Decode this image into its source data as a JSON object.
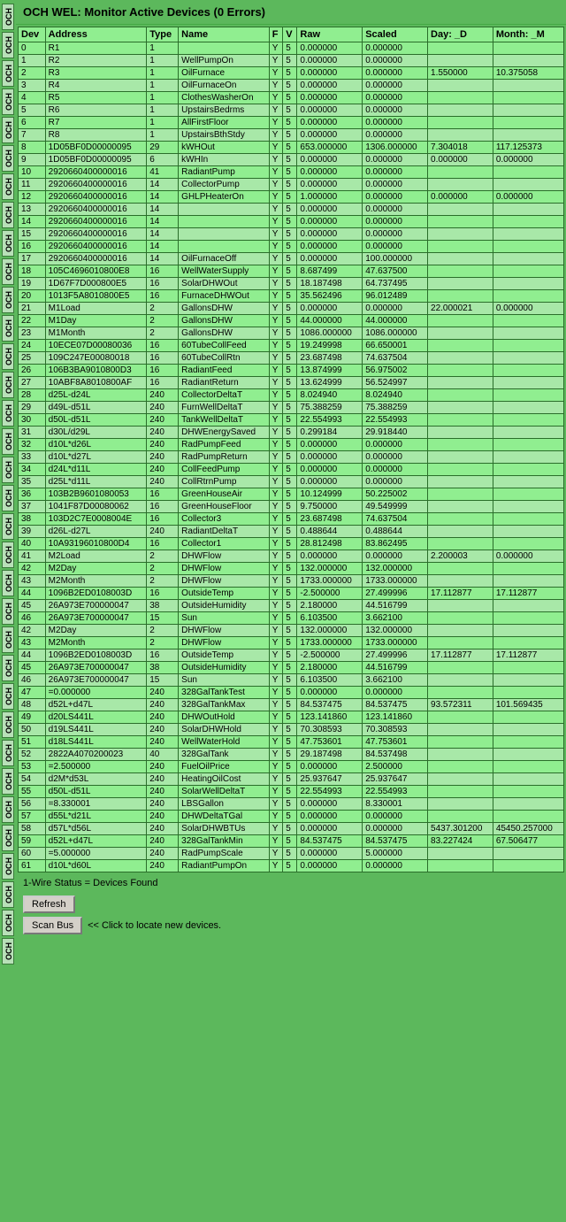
{
  "title": "OCH WEL: Monitor Active Devices (0 Errors)",
  "columns": [
    "Dev",
    "Address",
    "Type",
    "Name",
    "F",
    "V",
    "Raw",
    "Scaled",
    "Day: _D",
    "Month: _M"
  ],
  "rows": [
    [
      "0",
      "R1",
      "1",
      "",
      "Y",
      "5",
      "0.000000",
      "0.000000",
      "",
      ""
    ],
    [
      "1",
      "R2",
      "1",
      "WellPumpOn",
      "Y",
      "5",
      "0.000000",
      "0.000000",
      "",
      ""
    ],
    [
      "2",
      "R3",
      "1",
      "OilFurnace",
      "Y",
      "5",
      "0.000000",
      "0.000000",
      "1.550000",
      "10.375058"
    ],
    [
      "3",
      "R4",
      "1",
      "OilFurnaceOn",
      "Y",
      "5",
      "0.000000",
      "0.000000",
      "",
      ""
    ],
    [
      "4",
      "R5",
      "1",
      "ClothesWasherOn",
      "Y",
      "5",
      "0.000000",
      "0.000000",
      "",
      ""
    ],
    [
      "5",
      "R6",
      "1",
      "UpstairsBedrms",
      "Y",
      "5",
      "0.000000",
      "0.000000",
      "",
      ""
    ],
    [
      "6",
      "R7",
      "1",
      "AllFirstFloor",
      "Y",
      "5",
      "0.000000",
      "0.000000",
      "",
      ""
    ],
    [
      "7",
      "R8",
      "1",
      "UpstairsBthStdy",
      "Y",
      "5",
      "0.000000",
      "0.000000",
      "",
      ""
    ],
    [
      "8",
      "1D05BF0D00000095",
      "29",
      "kWHOut",
      "Y",
      "5",
      "653.000000",
      "1306.000000",
      "7.304018",
      "117.125373"
    ],
    [
      "9",
      "1D05BF0D00000095",
      "6",
      "kWHIn",
      "Y",
      "5",
      "0.000000",
      "0.000000",
      "0.000000",
      "0.000000"
    ],
    [
      "10",
      "2920660400000016",
      "41",
      "RadiantPump",
      "Y",
      "5",
      "0.000000",
      "0.000000",
      "",
      ""
    ],
    [
      "11",
      "2920660400000016",
      "14",
      "CollectorPump",
      "Y",
      "5",
      "0.000000",
      "0.000000",
      "",
      ""
    ],
    [
      "12",
      "2920660400000016",
      "14",
      "GHLPHeaterOn",
      "Y",
      "5",
      "1.000000",
      "0.000000",
      "0.000000",
      "0.000000"
    ],
    [
      "13",
      "2920660400000016",
      "14",
      "",
      "Y",
      "5",
      "0.000000",
      "0.000000",
      "",
      ""
    ],
    [
      "14",
      "2920660400000016",
      "14",
      "",
      "Y",
      "5",
      "0.000000",
      "0.000000",
      "",
      ""
    ],
    [
      "15",
      "2920660400000016",
      "14",
      "",
      "Y",
      "5",
      "0.000000",
      "0.000000",
      "",
      ""
    ],
    [
      "16",
      "2920660400000016",
      "14",
      "",
      "Y",
      "5",
      "0.000000",
      "0.000000",
      "",
      ""
    ],
    [
      "17",
      "2920660400000016",
      "14",
      "OilFurnaceOff",
      "Y",
      "5",
      "0.000000",
      "100.000000",
      "",
      ""
    ],
    [
      "18",
      "105C4696010800E8",
      "16",
      "WellWaterSupply",
      "Y",
      "5",
      "8.687499",
      "47.637500",
      "",
      ""
    ],
    [
      "19",
      "1D67F7D000800E5",
      "16",
      "SolarDHWOut",
      "Y",
      "5",
      "18.187498",
      "64.737495",
      "",
      ""
    ],
    [
      "20",
      "1013F5A8010800E5",
      "16",
      "FurnaceDHWOut",
      "Y",
      "5",
      "35.562496",
      "96.012489",
      "",
      ""
    ],
    [
      "21",
      "M1Load",
      "2",
      "GallonsDHW",
      "Y",
      "5",
      "0.000000",
      "0.000000",
      "22.000021",
      "0.000000"
    ],
    [
      "22",
      "M1Day",
      "2",
      "GallonsDHW",
      "Y",
      "5",
      "44.000000",
      "44.000000",
      "",
      ""
    ],
    [
      "23",
      "M1Month",
      "2",
      "GallonsDHW",
      "Y",
      "5",
      "1086.000000",
      "1086.000000",
      "",
      ""
    ],
    [
      "24",
      "10ECE07D00080036",
      "16",
      "60TubeCollFeed",
      "Y",
      "5",
      "19.249998",
      "66.650001",
      "",
      ""
    ],
    [
      "25",
      "109C247E00080018",
      "16",
      "60TubeCollRtn",
      "Y",
      "5",
      "23.687498",
      "74.637504",
      "",
      ""
    ],
    [
      "26",
      "106B3BA9010800D3",
      "16",
      "RadiantFeed",
      "Y",
      "5",
      "13.874999",
      "56.975002",
      "",
      ""
    ],
    [
      "27",
      "10ABF8A8010800AF",
      "16",
      "RadiantReturn",
      "Y",
      "5",
      "13.624999",
      "56.524997",
      "",
      ""
    ],
    [
      "28",
      "d25L-d24L",
      "240",
      "CollectorDeltaT",
      "Y",
      "5",
      "8.024940",
      "8.024940",
      "",
      ""
    ],
    [
      "29",
      "d49L-d51L",
      "240",
      "FurnWellDeltaT",
      "Y",
      "5",
      "75.388259",
      "75.388259",
      "",
      ""
    ],
    [
      "30",
      "d50L-d51L",
      "240",
      "TankWellDeltaT",
      "Y",
      "5",
      "22.554993",
      "22.554993",
      "",
      ""
    ],
    [
      "31",
      "d30L/d29L",
      "240",
      "DHWEnergySaved",
      "Y",
      "5",
      "0.299184",
      "29.918440",
      "",
      ""
    ],
    [
      "32",
      "d10L*d26L",
      "240",
      "RadPumpFeed",
      "Y",
      "5",
      "0.000000",
      "0.000000",
      "",
      ""
    ],
    [
      "33",
      "d10L*d27L",
      "240",
      "RadPumpReturn",
      "Y",
      "5",
      "0.000000",
      "0.000000",
      "",
      ""
    ],
    [
      "34",
      "d24L*d11L",
      "240",
      "CollFeedPump",
      "Y",
      "5",
      "0.000000",
      "0.000000",
      "",
      ""
    ],
    [
      "35",
      "d25L*d11L",
      "240",
      "CollRtrnPump",
      "Y",
      "5",
      "0.000000",
      "0.000000",
      "",
      ""
    ],
    [
      "36",
      "103B2B9601080053",
      "16",
      "GreenHouseAir",
      "Y",
      "5",
      "10.124999",
      "50.225002",
      "",
      ""
    ],
    [
      "37",
      "1041F87D00080062",
      "16",
      "GreenHouseFloor",
      "Y",
      "5",
      "9.750000",
      "49.549999",
      "",
      ""
    ],
    [
      "38",
      "103D2C7E0008004E",
      "16",
      "Collector3",
      "Y",
      "5",
      "23.687498",
      "74.637504",
      "",
      ""
    ],
    [
      "39",
      "d26L-d27L",
      "240",
      "RadiantDeltaT",
      "Y",
      "5",
      "0.488644",
      "0.488644",
      "",
      ""
    ],
    [
      "40",
      "10A93196010800D4",
      "16",
      "Collector1",
      "Y",
      "5",
      "28.812498",
      "83.862495",
      "",
      ""
    ],
    [
      "41",
      "M2Load",
      "2",
      "DHWFlow",
      "Y",
      "5",
      "0.000000",
      "0.000000",
      "2.200003",
      "0.000000"
    ],
    [
      "42",
      "M2Day",
      "2",
      "DHWFlow",
      "Y",
      "5",
      "132.000000",
      "132.000000",
      "",
      ""
    ],
    [
      "43",
      "M2Month",
      "2",
      "DHWFlow",
      "Y",
      "5",
      "1733.000000",
      "1733.000000",
      "",
      ""
    ],
    [
      "44",
      "1096B2ED0108003D",
      "16",
      "OutsideTemp",
      "Y",
      "5",
      "-2.500000",
      "27.499996",
      "17.112877",
      "17.112877"
    ],
    [
      "45",
      "26A973E700000047",
      "38",
      "OutsideHumidity",
      "Y",
      "5",
      "2.180000",
      "44.516799",
      "",
      ""
    ],
    [
      "46",
      "26A973E700000047",
      "15",
      "Sun",
      "Y",
      "5",
      "6.103500",
      "3.662100",
      "",
      ""
    ],
    [
      "42",
      "M2Day",
      "2",
      "DHWFlow",
      "Y",
      "5",
      "132.000000",
      "132.000000",
      "",
      ""
    ],
    [
      "43",
      "M2Month",
      "2",
      "DHWFlow",
      "Y",
      "5",
      "1733.000000",
      "1733.000000",
      "",
      ""
    ],
    [
      "44",
      "1096B2ED0108003D",
      "16",
      "OutsideTemp",
      "Y",
      "5",
      "-2.500000",
      "27.499996",
      "17.112877",
      "17.112877"
    ],
    [
      "45",
      "26A973E700000047",
      "38",
      "OutsideHumidity",
      "Y",
      "5",
      "2.180000",
      "44.516799",
      "",
      ""
    ],
    [
      "46",
      "26A973E700000047",
      "15",
      "Sun",
      "Y",
      "5",
      "6.103500",
      "3.662100",
      "",
      ""
    ],
    [
      "47",
      "=0.000000",
      "240",
      "328GalTankTest",
      "Y",
      "5",
      "0.000000",
      "0.000000",
      "",
      ""
    ],
    [
      "48",
      "d52L+d47L",
      "240",
      "328GalTankMax",
      "Y",
      "5",
      "84.537475",
      "84.537475",
      "93.572311",
      "101.569435"
    ],
    [
      "49",
      "d20LS441L",
      "240",
      "DHWOutHold",
      "Y",
      "5",
      "123.141860",
      "123.141860",
      "",
      ""
    ],
    [
      "50",
      "d19LS441L",
      "240",
      "SolarDHWHold",
      "Y",
      "5",
      "70.308593",
      "70.308593",
      "",
      ""
    ],
    [
      "51",
      "d18LS441L",
      "240",
      "WellWaterHold",
      "Y",
      "5",
      "47.753601",
      "47.753601",
      "",
      ""
    ],
    [
      "52",
      "2822A4070200023",
      "40",
      "328GalTank",
      "Y",
      "5",
      "29.187498",
      "84.537498",
      "",
      ""
    ],
    [
      "53",
      "=2.500000",
      "240",
      "FuelOilPrice",
      "Y",
      "5",
      "0.000000",
      "2.500000",
      "",
      ""
    ],
    [
      "54",
      "d2M*d53L",
      "240",
      "HeatingOilCost",
      "Y",
      "5",
      "25.937647",
      "25.937647",
      "",
      ""
    ],
    [
      "55",
      "d50L-d51L",
      "240",
      "SolarWellDeltaT",
      "Y",
      "5",
      "22.554993",
      "22.554993",
      "",
      ""
    ],
    [
      "56",
      "=8.330001",
      "240",
      "LBSGallon",
      "Y",
      "5",
      "0.000000",
      "8.330001",
      "",
      ""
    ],
    [
      "57",
      "d55L*d21L",
      "240",
      "DHWDeltaTGal",
      "Y",
      "5",
      "0.000000",
      "0.000000",
      "",
      ""
    ],
    [
      "58",
      "d57L*d56L",
      "240",
      "SolarDHWBTUs",
      "Y",
      "5",
      "0.000000",
      "0.000000",
      "5437.301200",
      "45450.257000"
    ],
    [
      "59",
      "d52L+d47L",
      "240",
      "328GalTankMin",
      "Y",
      "5",
      "84.537475",
      "84.537475",
      "83.227424",
      "67.506477"
    ],
    [
      "60",
      "=5.000000",
      "240",
      "RadPumpScale",
      "Y",
      "5",
      "0.000000",
      "5.000000",
      "",
      ""
    ],
    [
      "61",
      "d10L*d60L",
      "240",
      "RadiantPumpOn",
      "Y",
      "5",
      "0.000000",
      "0.000000",
      "",
      ""
    ]
  ],
  "status_text": "1-Wire Status = Devices Found",
  "refresh_button": "Refresh",
  "scan_bus_button": "Scan Bus",
  "scan_note": "<< Click to locate new devices.",
  "sidebar_labels": [
    "OCH",
    "OCH",
    "OCH",
    "OCH",
    "OCH",
    "OCH",
    "OCH",
    "OCH",
    "OCH",
    "OCH",
    "OCH",
    "OCH",
    "OCH",
    "OCH",
    "OCH",
    "OCH",
    "OCH",
    "OCH",
    "OCH",
    "OCH",
    "OCH",
    "OCH",
    "OCH",
    "OCH",
    "OCH",
    "OCH",
    "OCH",
    "OCH",
    "OCH",
    "OCH",
    "OCH",
    "OCH",
    "OCH",
    "OCH"
  ]
}
